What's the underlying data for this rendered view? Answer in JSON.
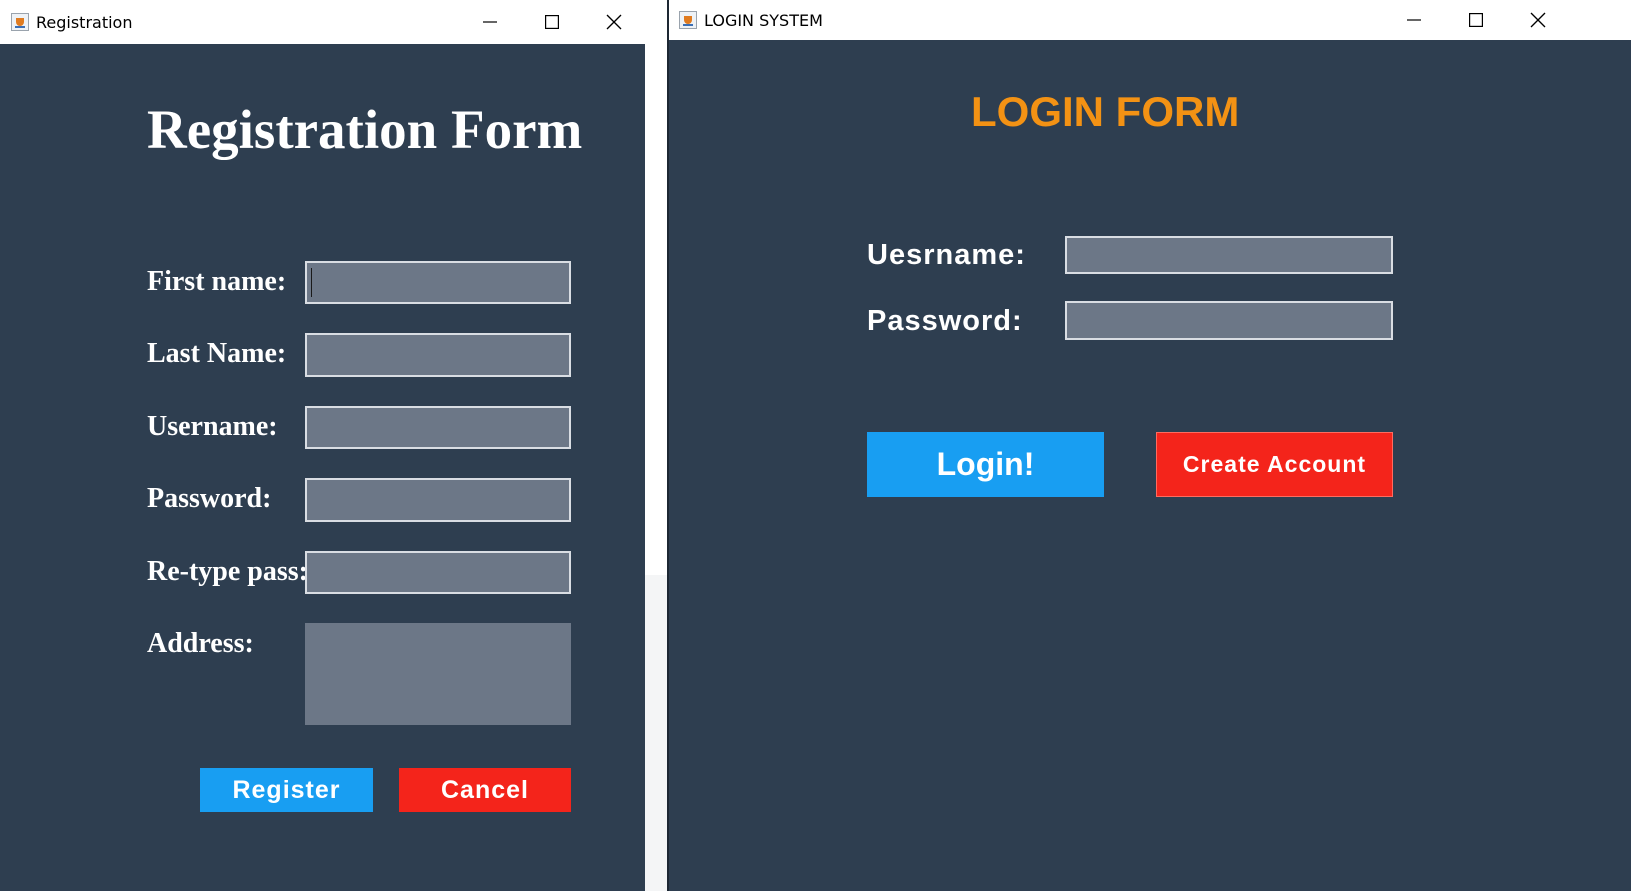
{
  "registration_window": {
    "title": "Registration",
    "heading": "Registration Form",
    "fields": [
      {
        "label": "First name:",
        "value": ""
      },
      {
        "label": "Last Name:",
        "value": ""
      },
      {
        "label": "Username:",
        "value": ""
      },
      {
        "label": "Password:",
        "value": ""
      },
      {
        "label": "Re-type pass:",
        "value": ""
      }
    ],
    "address_label": "Address:",
    "address_value": "",
    "register_label": "Register",
    "cancel_label": "Cancel"
  },
  "login_window": {
    "title": "LOGIN SYSTEM",
    "heading": "LOGIN FORM",
    "username_label": "Uesrname:",
    "username_value": "",
    "password_label": "Password:",
    "password_value": "",
    "login_label": "Login!",
    "create_account_label": "Create Account"
  },
  "colors": {
    "window_background": "#2e3e50",
    "input_background": "#6c7787",
    "heading_orange": "#f39214",
    "button_blue": "#189ef2",
    "button_red": "#f4241b"
  },
  "icons": {
    "app": "java-cup-icon",
    "minimize": "minimize-icon",
    "maximize": "maximize-icon",
    "close": "close-icon"
  }
}
